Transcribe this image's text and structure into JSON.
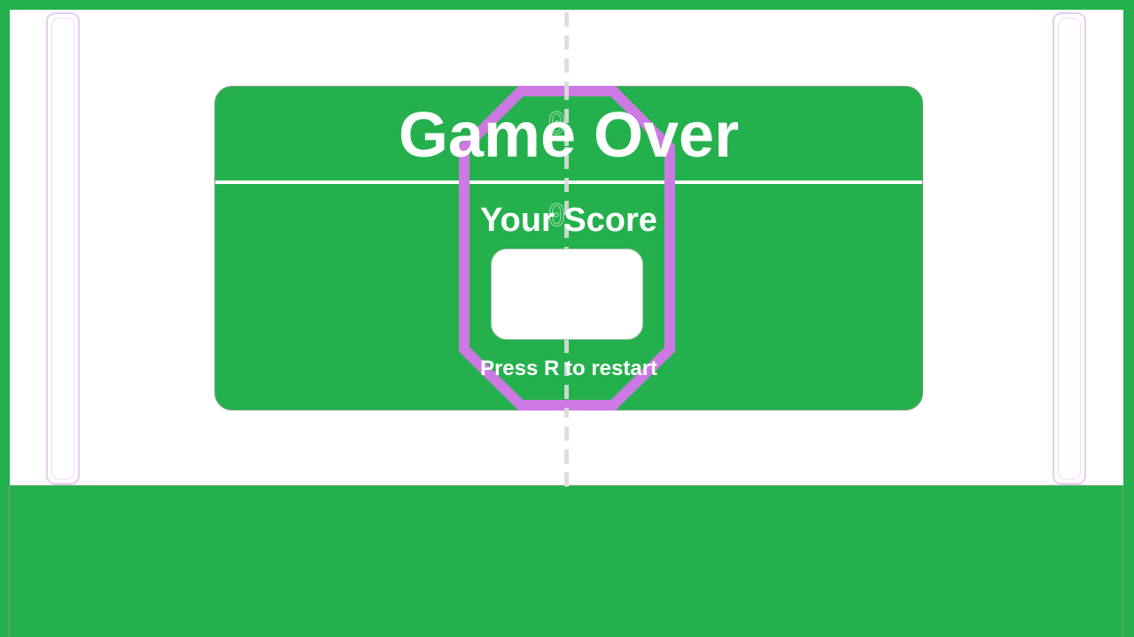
{
  "overlay": {
    "title": "Game Over",
    "score_label": "Your Score",
    "score_value": "",
    "restart_hint": "Press R to restart"
  },
  "colors": {
    "background": "#24b14d",
    "arena": "#ffffff",
    "paddle_outline": "#e8cdee",
    "ball_outline": "#cd79e3",
    "text": "#ffffff"
  },
  "icons": {
    "ball": "octagon-ball-icon",
    "paddle_left": "paddle-left-icon",
    "paddle_right": "paddle-right-icon"
  }
}
